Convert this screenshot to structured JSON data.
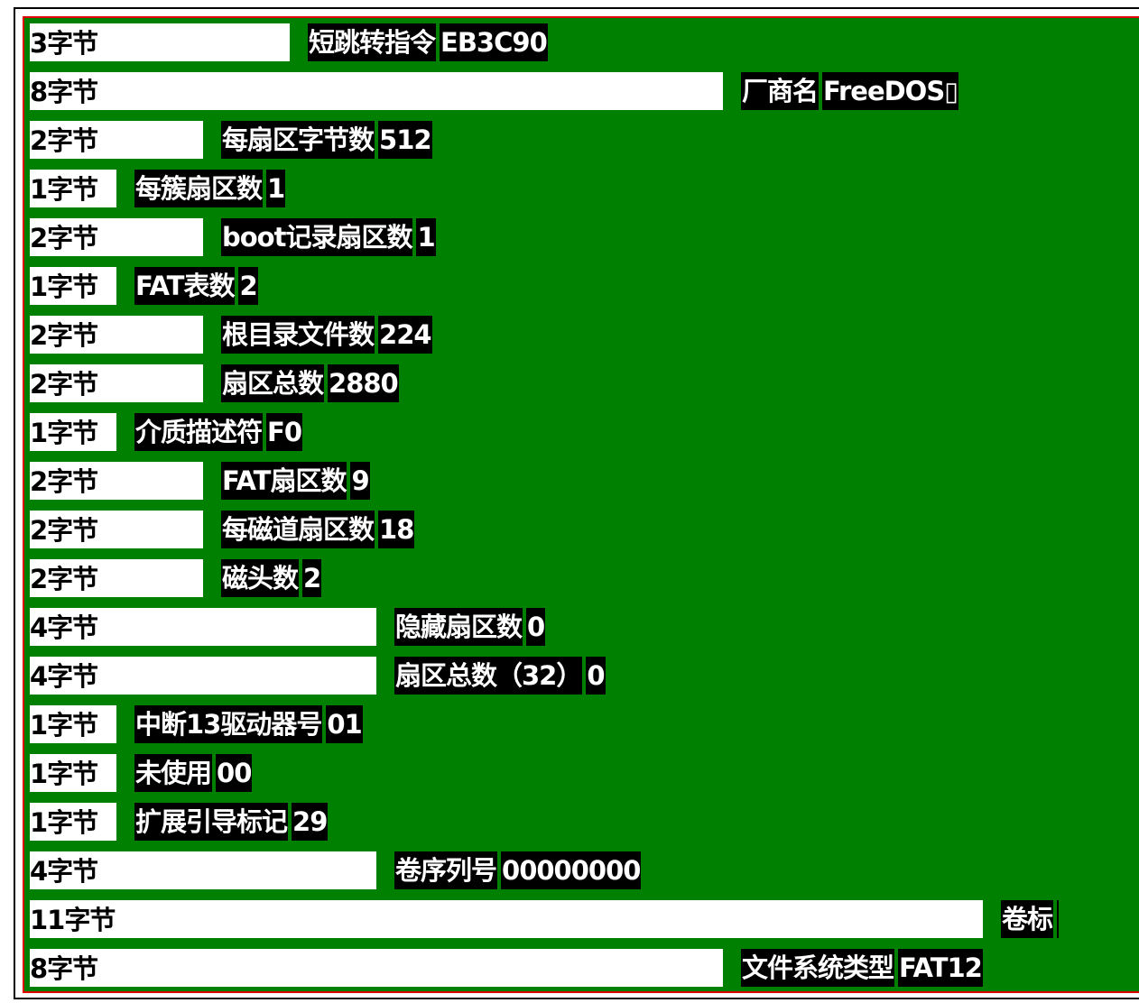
{
  "fields": [
    {
      "size": 3,
      "bytes_label": "3字节",
      "name": "短跳转指令",
      "value": "EB3C90"
    },
    {
      "size": 8,
      "bytes_label": "8字节",
      "name": "厂商名",
      "value": "FreeDOS▯"
    },
    {
      "size": 2,
      "bytes_label": "2字节",
      "name": "每扇区字节数",
      "value": "512"
    },
    {
      "size": 1,
      "bytes_label": "1字节",
      "name": "每簇扇区数",
      "value": "1"
    },
    {
      "size": 2,
      "bytes_label": "2字节",
      "name": "boot记录扇区数",
      "value": "1"
    },
    {
      "size": 1,
      "bytes_label": "1字节",
      "name": "FAT表数",
      "value": "2"
    },
    {
      "size": 2,
      "bytes_label": "2字节",
      "name": "根目录文件数",
      "value": "224"
    },
    {
      "size": 2,
      "bytes_label": "2字节",
      "name": "扇区总数",
      "value": "2880"
    },
    {
      "size": 1,
      "bytes_label": "1字节",
      "name": "介质描述符",
      "value": "F0"
    },
    {
      "size": 2,
      "bytes_label": "2字节",
      "name": "FAT扇区数",
      "value": "9"
    },
    {
      "size": 2,
      "bytes_label": "2字节",
      "name": "每磁道扇区数",
      "value": "18"
    },
    {
      "size": 2,
      "bytes_label": "2字节",
      "name": "磁头数",
      "value": "2"
    },
    {
      "size": 4,
      "bytes_label": "4字节",
      "name": "隐藏扇区数",
      "value": "0"
    },
    {
      "size": 4,
      "bytes_label": "4字节",
      "name": "扇区总数（32）",
      "value": "0"
    },
    {
      "size": 1,
      "bytes_label": "1字节",
      "name": "中断13驱动器号",
      "value": "01"
    },
    {
      "size": 1,
      "bytes_label": "1字节",
      "name": "未使用",
      "value": "00"
    },
    {
      "size": 1,
      "bytes_label": "1字节",
      "name": "扩展引导标记",
      "value": "29"
    },
    {
      "size": 4,
      "bytes_label": "4字节",
      "name": "卷序列号",
      "value": "00000000"
    },
    {
      "size": 11,
      "bytes_label": "11字节",
      "name": "卷标",
      "value": ""
    },
    {
      "size": 8,
      "bytes_label": "8字节",
      "name": "文件系统类型",
      "value": "FAT12"
    }
  ],
  "colors": {
    "background": "#008000",
    "border": "#e00000",
    "label_bg": "#000000",
    "bytes_bg": "#ffffff"
  }
}
